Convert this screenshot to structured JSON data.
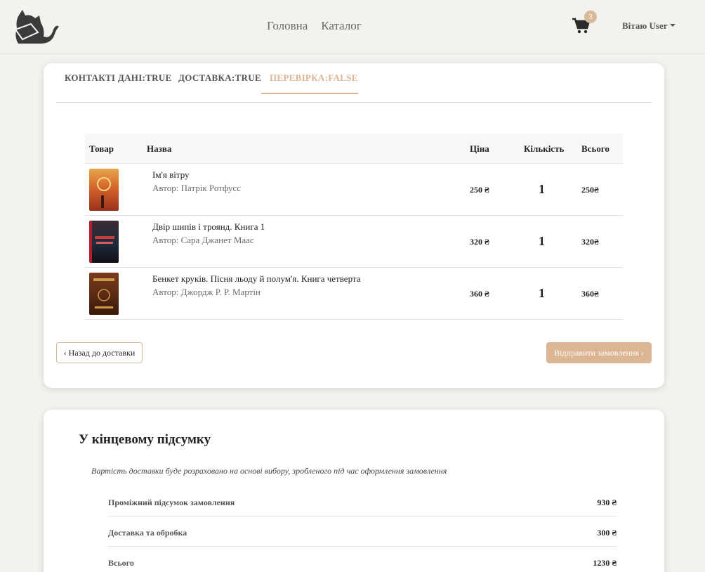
{
  "header": {
    "nav": [
      "Головна",
      "Каталог"
    ],
    "cart_count": "3",
    "user_label": "Вітаю User"
  },
  "checkout": {
    "tabs": [
      "КОНТАКТІ ДАНІ:TRUE",
      "ДОСТАВКА:TRUE",
      "ПЕРЕВІРКА:FALSE"
    ],
    "columns": {
      "product": "Товар",
      "name": "Назва",
      "price": "Ціна",
      "quantity": "Кількість",
      "total": "Всього"
    },
    "items": [
      {
        "title": "Ім'я вітру",
        "author": "Автор: Патрік Ротфусс",
        "price": "250 ₴",
        "qty": "1",
        "total": "250₴"
      },
      {
        "title": "Двір шипів і троянд. Книга 1",
        "author": "Автор: Сара Джанет Маас",
        "price": "320 ₴",
        "qty": "1",
        "total": "320₴"
      },
      {
        "title": "Бенкет круків. Пісня льоду й полум'я. Книга четверта",
        "author": "Автор: Джордж Р. Р. Мартін",
        "price": "360 ₴",
        "qty": "1",
        "total": "360₴"
      }
    ],
    "back_button": "‹ Назад до доставки",
    "submit_button": "Відправити замовлення ›"
  },
  "summary": {
    "title": "У кінцевому підсумку",
    "note": "Вартість доставки буде розраховано на основі вибору, зробленого під час оформлення замовлення",
    "rows": [
      {
        "label": "Проміжний підсумок замовлення",
        "value": "930 ₴"
      },
      {
        "label": "Доставка та обробка",
        "value": "300 ₴"
      },
      {
        "label": "Всього",
        "value": "1230 ₴"
      }
    ]
  },
  "colors": {
    "accent": "#dcb592",
    "background": "#f3f2ee"
  }
}
